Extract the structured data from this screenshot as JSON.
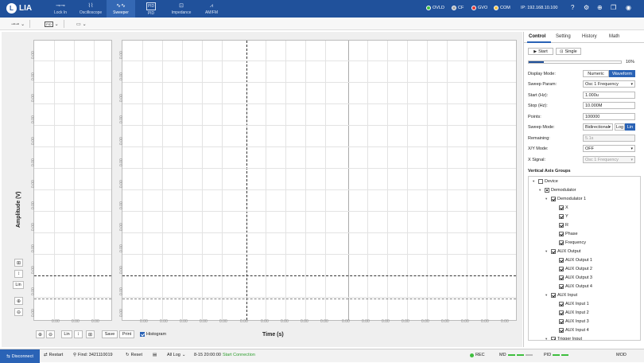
{
  "app": {
    "logo_letter": "L",
    "logo_text": "LIA"
  },
  "nav": [
    {
      "label": "Lock In",
      "icon": "lockin-icon",
      "glyph": "⊸⊸"
    },
    {
      "label": "Oscilloscope",
      "icon": "oscilloscope-icon",
      "glyph": "⌇⌇"
    },
    {
      "label": "Sweeper",
      "icon": "sweeper-icon",
      "glyph": "∿∿"
    },
    {
      "label": "PID",
      "icon": "pid-icon",
      "glyph": "PID"
    },
    {
      "label": "Impedance",
      "icon": "impedance-icon",
      "glyph": "⊡"
    },
    {
      "label": "AM/FM",
      "icon": "amfm-icon",
      "glyph": "⩘"
    }
  ],
  "status": {
    "ovld": "OVLD",
    "cf": "CF",
    "gvo": "GVO",
    "com": "COM",
    "ip": "IP: 192.168.10.100"
  },
  "colors": {
    "topbar": "#20519b",
    "accent": "#2a63b6",
    "ovld": "#3fbf3f",
    "cf": "#aaaaaa",
    "gvo": "#e53935",
    "com": "#f0c040"
  },
  "plot": {
    "y_title": "Amplitude (V)",
    "x_title": "Time (s)",
    "tick": "0.00",
    "x_scale": "Lin",
    "save": "Save",
    "print": "Print",
    "histogram": "Histogram"
  },
  "panel": {
    "tabs": [
      "Control",
      "Setting",
      "History",
      "Math"
    ],
    "start": "Start",
    "single": "Single",
    "progress_label": "16%",
    "progress": 0.16,
    "display_mode_label": "Display Mode:",
    "numeric": "Numeric",
    "waveform": "Waveform",
    "sweep_param_label": "Sweep Param:",
    "sweep_param": "Osc 1 Frequency",
    "start_hz_label": "Start (Hz):",
    "start_hz": "1.000u",
    "stop_hz_label": "Stop (Hz):",
    "stop_hz": "10.000M",
    "points_label": "Points:",
    "points": "100000",
    "sweep_mode_label": "Sweep Mode:",
    "sweep_mode": "Bidirectional",
    "log": "Log",
    "lin": "Lin",
    "remaining_label": "Remaining:",
    "remaining": "5.1s",
    "xy_mode_label": "X/Y Mode:",
    "xy_mode": "OFF",
    "x_signal_label": "X Signal:",
    "x_signal": "Osc 1 Frequency",
    "vag_title": "Vertical Axis Groups"
  },
  "tree": [
    {
      "label": "Device",
      "level": 0,
      "state": "off",
      "arrow": true
    },
    {
      "label": "Demodulator",
      "level": 1,
      "state": "part",
      "arrow": true
    },
    {
      "label": "Demodulator 1",
      "level": 2,
      "state": "on",
      "arrow": true
    },
    {
      "label": "X",
      "level": 3,
      "state": "on",
      "arrow": false
    },
    {
      "label": "Y",
      "level": 3,
      "state": "on",
      "arrow": false
    },
    {
      "label": "R",
      "level": 3,
      "state": "on",
      "arrow": false
    },
    {
      "label": "Phase",
      "level": 3,
      "state": "on",
      "arrow": false
    },
    {
      "label": "Frequency",
      "level": 3,
      "state": "on",
      "arrow": false
    },
    {
      "label": "AUX Output",
      "level": 2,
      "state": "on",
      "arrow": true
    },
    {
      "label": "AUX Output 1",
      "level": 3,
      "state": "on",
      "arrow": false
    },
    {
      "label": "AUX Output 2",
      "level": 3,
      "state": "on",
      "arrow": false
    },
    {
      "label": "AUX Output 3",
      "level": 3,
      "state": "on",
      "arrow": false
    },
    {
      "label": "AUX Output 4",
      "level": 3,
      "state": "on",
      "arrow": false
    },
    {
      "label": "AUX Input",
      "level": 2,
      "state": "on",
      "arrow": true
    },
    {
      "label": "AUX Input 1",
      "level": 3,
      "state": "on",
      "arrow": false
    },
    {
      "label": "AUX Input 2",
      "level": 3,
      "state": "on",
      "arrow": false
    },
    {
      "label": "AUX Input 3",
      "level": 3,
      "state": "on",
      "arrow": false
    },
    {
      "label": "AUX Input 4",
      "level": 3,
      "state": "on",
      "arrow": false
    },
    {
      "label": "Trigger Input",
      "level": 2,
      "state": "on",
      "arrow": true
    }
  ],
  "bottom": {
    "disconnect": "Disconnect",
    "restart": "Restart",
    "find": "Find: 3421110019",
    "reset": "Reset",
    "all_log": "All Log",
    "log_time": "8-15 20:00:00",
    "log_msg": "Start Connection",
    "rec": "REC",
    "md": "MD",
    "pid": "PID",
    "mod": "MOD"
  }
}
